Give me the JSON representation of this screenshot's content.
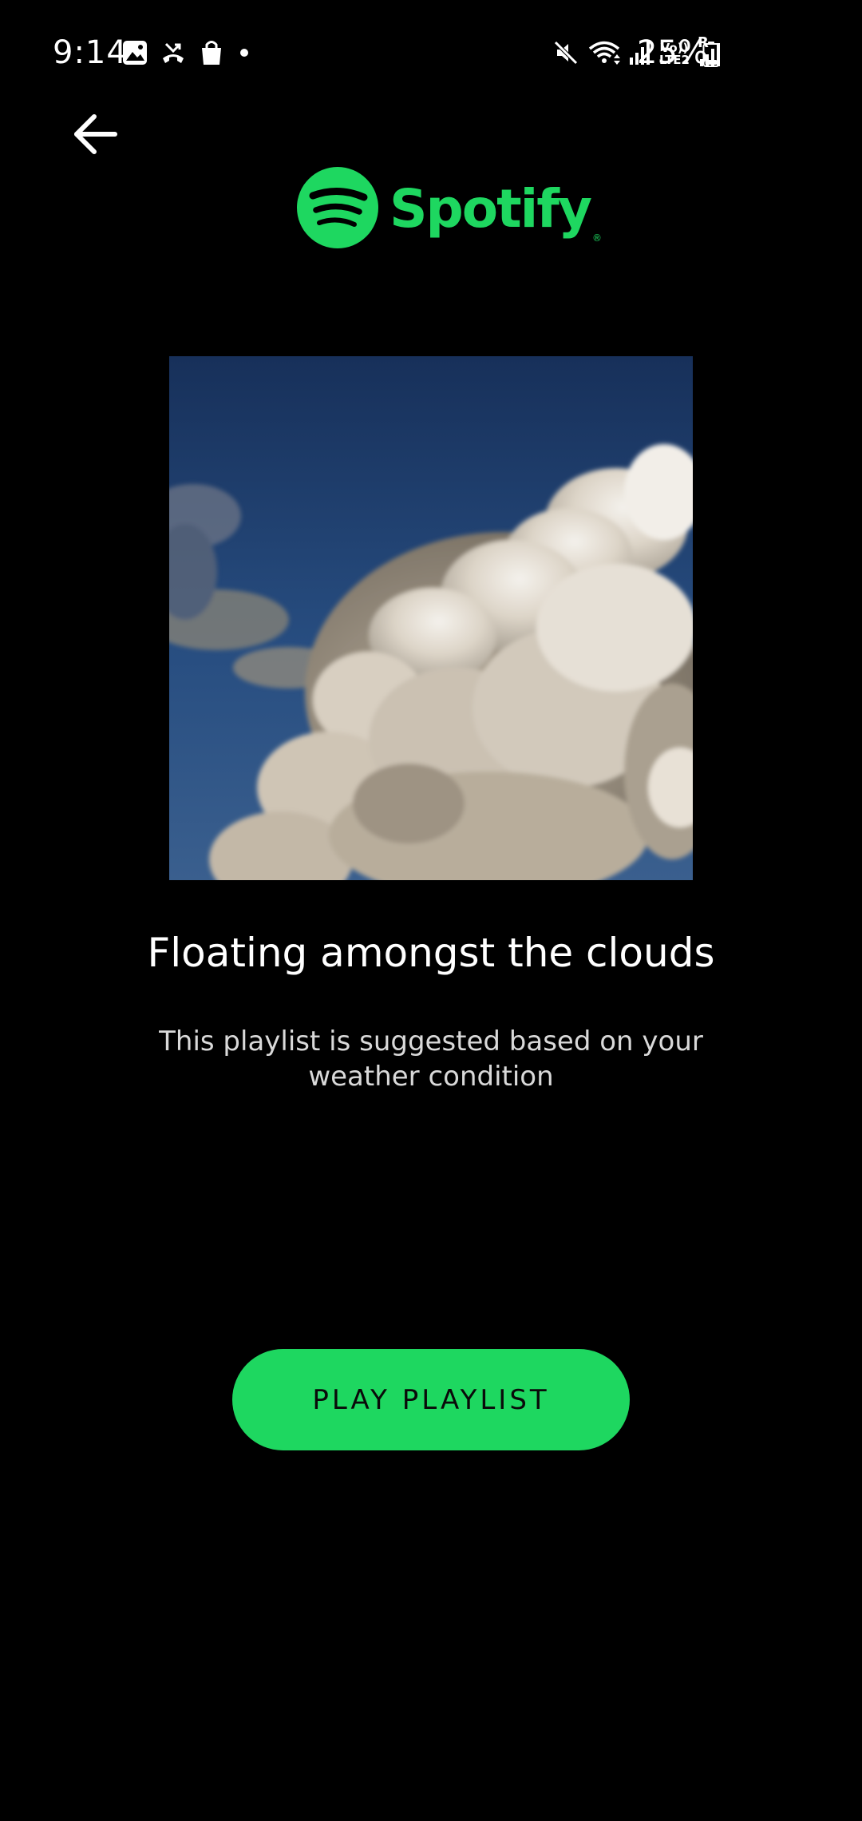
{
  "status_bar": {
    "time": "9:14",
    "left_icons": [
      "gallery-icon",
      "missed-call-icon",
      "shopping-bag-icon",
      "notification-dot-icon"
    ],
    "right_icons": [
      "mute-icon",
      "wifi-icon",
      "signal-icon",
      "volte-lte2-icon",
      "roaming-signal-icon"
    ],
    "volte_top": "Vo))",
    "volte_bottom": "LTE2",
    "roaming_mark": "R",
    "battery": "25%",
    "battery_level": 0.25
  },
  "header": {
    "back_icon": "arrow-left-icon",
    "logo_text": "Spotify",
    "logo_reg": "®",
    "brand_color": "#1ed760"
  },
  "playlist": {
    "artwork_icon": "clouds-artwork-image",
    "title": "Floating amongst the clouds",
    "description": "This playlist is suggested based on your weather condition",
    "button_label": "PLAY PLAYLIST"
  },
  "colors": {
    "background": "#000000",
    "accent": "#1ed760",
    "button_text": "#0a0a0a",
    "description_text": "#d9d9d9"
  }
}
